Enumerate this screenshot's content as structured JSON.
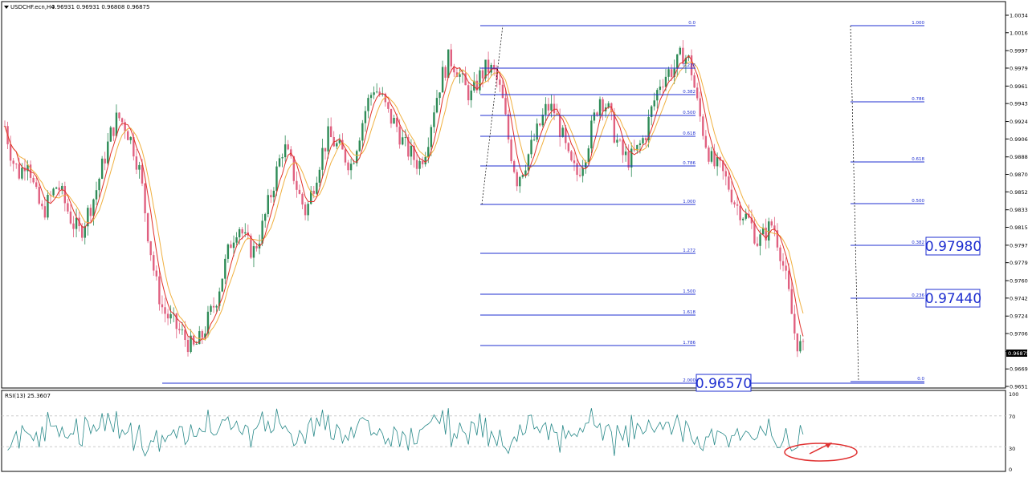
{
  "header": {
    "title": "USDCHF.ecn,H4",
    "ohlc": "0.96931 0.96931 0.96808 0.96875"
  },
  "rsi": {
    "label": "RSI(13) 25.3607",
    "levels": [
      100,
      70,
      30,
      0
    ],
    "level_labels": [
      "100",
      "70",
      "30",
      "0"
    ]
  },
  "colors": {
    "bull": "#2e8b57",
    "bear": "#e06080",
    "ma_fast": "#e0302a",
    "ma_slow": "#f0b040",
    "fib": "#1f2fd0",
    "rsi_line": "#2a8a8a",
    "ellipse": "#e03030",
    "grid": "#cccccc"
  },
  "price_scale": {
    "ticks": [
      "1.00340",
      "1.00160",
      "0.99975",
      "0.99795",
      "0.99610",
      "0.99430",
      "0.99245",
      "0.99065",
      "0.98880",
      "0.98700",
      "0.98520",
      "0.98335",
      "0.98155",
      "0.97970",
      "0.97790",
      "0.97605",
      "0.97425",
      "0.97240",
      "0.97060",
      "0.96875",
      "0.96695",
      "0.96515"
    ],
    "current": "0.96875"
  },
  "fib_retracement": {
    "levels": [
      "0.0",
      "0.236",
      "0.382",
      "0.500",
      "0.618",
      "0.786",
      "1.000",
      "1.272",
      "1.500",
      "1.618",
      "1.786",
      "2.000"
    ]
  },
  "fib_right": {
    "levels": [
      "1.000",
      "0.786",
      "0.618",
      "0.500",
      "0.382",
      "0.236",
      "0.0"
    ]
  },
  "price_labels": {
    "label_1": "0.97980",
    "label_2": "0.97440",
    "label_3": "0.96570"
  },
  "chart_data": {
    "type": "candlestick",
    "symbol": "USDCHF.ecn",
    "timeframe": "H4",
    "ylim": [
      0.965,
      1.004
    ],
    "close_series": [
      0.992,
      0.9885,
      0.987,
      0.989,
      0.985,
      0.983,
      0.9845,
      0.986,
      0.984,
      0.982,
      0.981,
      0.983,
      0.985,
      0.988,
      0.991,
      0.993,
      0.992,
      0.99,
      0.987,
      0.981,
      0.976,
      0.973,
      0.972,
      0.971,
      0.97,
      0.969,
      0.97,
      0.972,
      0.974,
      0.977,
      0.98,
      0.982,
      0.98,
      0.979,
      0.981,
      0.984,
      0.987,
      0.99,
      0.988,
      0.985,
      0.983,
      0.986,
      0.989,
      0.991,
      0.99,
      0.989,
      0.988,
      0.991,
      0.994,
      0.996,
      0.995,
      0.993,
      0.992,
      0.99,
      0.989,
      0.988,
      0.99,
      0.994,
      0.997,
      0.999,
      0.998,
      0.996,
      0.995,
      0.997,
      0.998,
      0.9975,
      0.995,
      0.99,
      0.9865,
      0.988,
      0.99,
      0.992,
      0.994,
      0.9935,
      0.991,
      0.988,
      0.987,
      0.989,
      0.992,
      0.995,
      0.994,
      0.991,
      0.989,
      0.9885,
      0.9895,
      0.991,
      0.994,
      0.9965,
      0.9975,
      0.998,
      0.9995,
      0.9985,
      0.994,
      0.9905,
      0.988,
      0.9875,
      0.986,
      0.984,
      0.983,
      0.982,
      0.98,
      0.981,
      0.982,
      0.979,
      0.975,
      0.97,
      0.96875
    ]
  }
}
